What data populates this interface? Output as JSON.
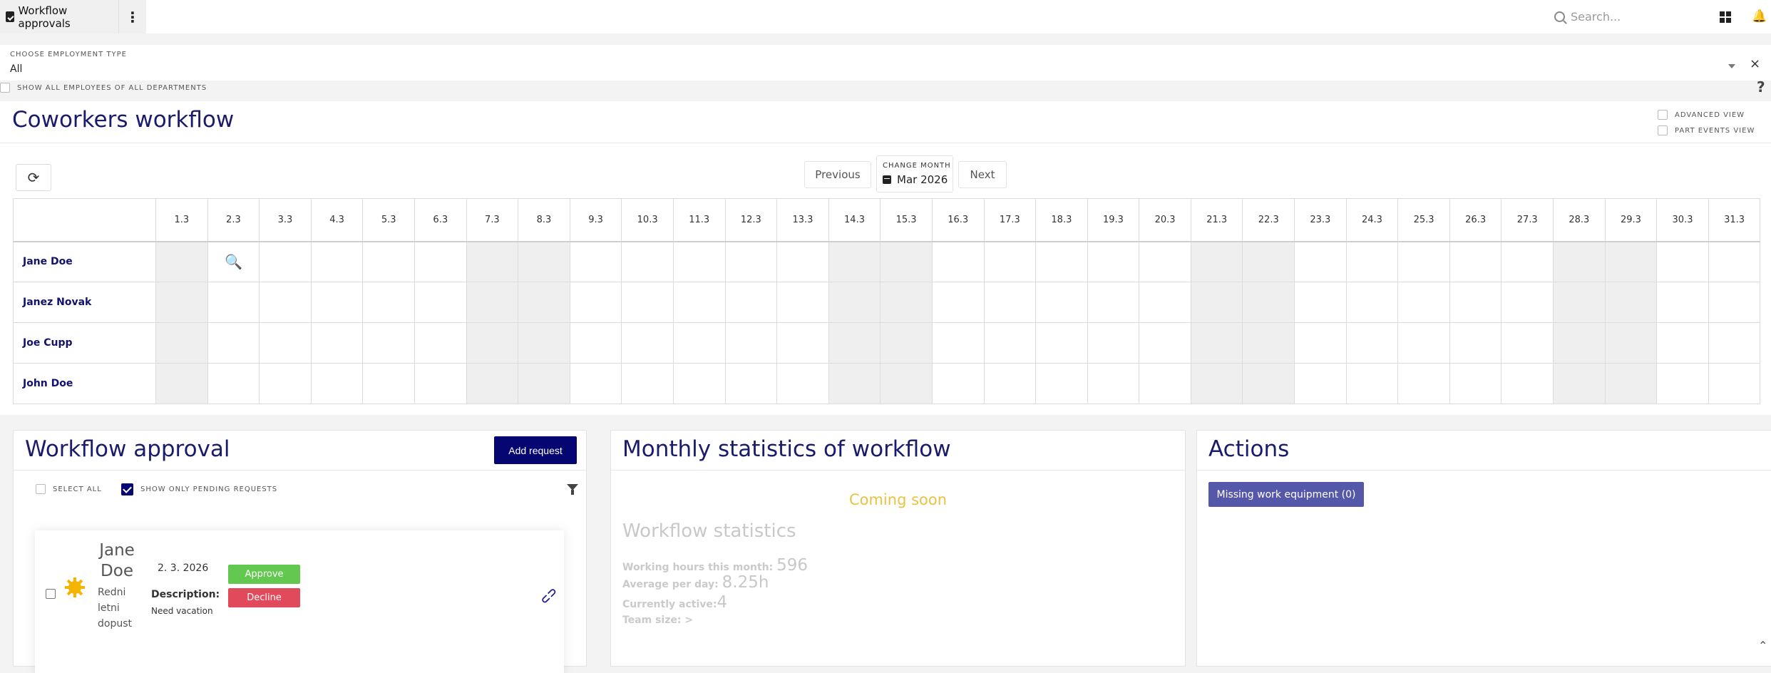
{
  "topbar": {
    "app_title": "Workflow approvals",
    "menu_glyph": "⋮",
    "search_placeholder": "Search..."
  },
  "employment": {
    "label": "CHOOSE EMPLOYMENT TYPE",
    "value": "All",
    "clear_glyph": "×",
    "show_all_label": "SHOW ALL EMPLOYEES OF ALL DEPARTMENTS",
    "help_glyph": "?"
  },
  "coworkers": {
    "title": "Coworkers workflow",
    "advanced_view_label": "ADVANCED VIEW",
    "part_events_label": "PART EVENTS VIEW",
    "refresh_glyph": "⟳",
    "previous_label": "Previous",
    "next_label": "Next",
    "change_month_label": "CHANGE MONTH",
    "month_value": "Mar 2026",
    "days": [
      "1.3",
      "2.3",
      "3.3",
      "4.3",
      "5.3",
      "6.3",
      "7.3",
      "8.3",
      "9.3",
      "10.3",
      "11.3",
      "12.3",
      "13.3",
      "14.3",
      "15.3",
      "16.3",
      "17.3",
      "18.3",
      "19.3",
      "20.3",
      "21.3",
      "22.3",
      "23.3",
      "24.3",
      "25.3",
      "26.3",
      "27.3",
      "28.3",
      "29.3",
      "30.3",
      "31.3"
    ],
    "weekend_days": [
      1,
      7,
      8,
      14,
      15,
      21,
      22,
      28,
      29
    ],
    "employees": [
      {
        "name": "Jane Doe",
        "marked_days": [
          2
        ]
      },
      {
        "name": "Janez Novak",
        "marked_days": []
      },
      {
        "name": "Joe Cupp",
        "marked_days": []
      },
      {
        "name": "John Doe",
        "marked_days": []
      }
    ],
    "marker_glyph": "🔍"
  },
  "approval": {
    "title": "Workflow approval",
    "add_request_label": "Add request",
    "select_all_label": "SELECT ALL",
    "pending_only_label": "SHOW ONLY PENDING REQUESTS",
    "request": {
      "name": "Jane Doe",
      "type": "Redni letni dopust",
      "date": "2. 3. 2026",
      "description_label": "Description:",
      "description": "Need vacation",
      "approve_label": "Approve",
      "decline_label": "Decline"
    }
  },
  "stats": {
    "title": "Monthly statistics of workflow",
    "coming_soon": "Coming soon",
    "workflow_title": "Workflow statistics",
    "working_hours_label": "Working hours this month:",
    "working_hours_value": "596",
    "avg_label": "Average per day:",
    "avg_value": "8.25h",
    "active_label": "Currently active:",
    "active_value": "4",
    "team_label": "Team size:",
    "team_value": ">"
  },
  "actions": {
    "title": "Actions",
    "missing_equipment_label": "Missing work equipment (0)"
  },
  "colors": {
    "primary": "#060672",
    "title": "#1b1b6b",
    "approve": "#63c84f",
    "decline": "#e04a5a",
    "action_button": "#5558a8",
    "coming_soon": "#e8c342"
  }
}
